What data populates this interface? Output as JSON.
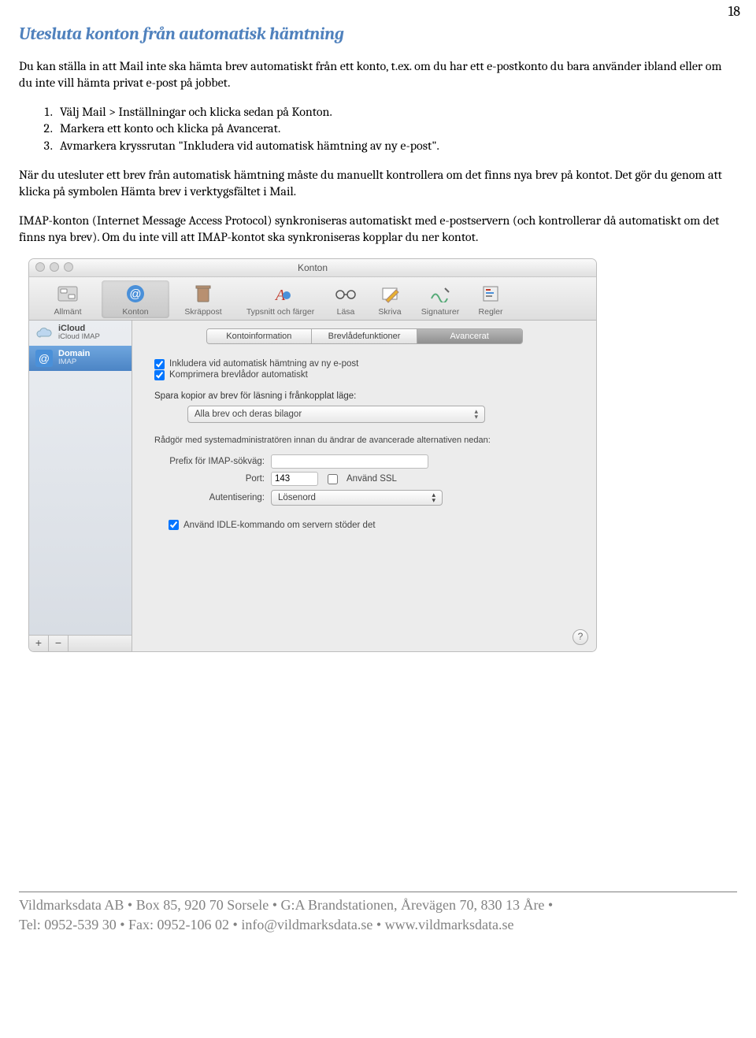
{
  "page_number": "18",
  "heading": "Utesluta konton från automatisk hämtning",
  "intro": "Du kan ställa in att Mail inte ska hämta brev automatiskt från ett konto, t.ex. om du har ett e-postkonto du bara använder ibland eller om du inte vill hämta privat e-post på jobbet.",
  "steps": [
    "Välj Mail > Inställningar och klicka sedan på Konton.",
    "Markera ett konto och klicka på Avancerat.",
    "Avmarkera kryssrutan \"Inkludera vid automatisk hämtning av ny e-post\"."
  ],
  "para2": "När du utesluter ett brev från automatisk hämtning måste du manuellt kontrollera om det finns nya brev på kontot. Det gör du genom att klicka på symbolen Hämta brev i verktygsfältet i Mail.",
  "para3": "IMAP-konton (Internet Message Access Protocol) synkroniseras automatiskt med e-postservern (och kontrollerar då automatiskt om det finns nya brev). Om du inte vill att IMAP-kontot ska synkroniseras kopplar du ner kontot.",
  "window": {
    "title": "Konton",
    "toolbar": [
      "Allmänt",
      "Konton",
      "Skräppost",
      "Typsnitt och färger",
      "Läsa",
      "Skriva",
      "Signaturer",
      "Regler"
    ],
    "accounts": [
      {
        "name": "iCloud",
        "sub": "iCloud IMAP"
      },
      {
        "name": "Domain",
        "sub": "IMAP"
      }
    ],
    "seg": [
      "Kontoinformation",
      "Brevlådefunktioner",
      "Avancerat"
    ],
    "chk1": "Inkludera vid automatisk hämtning av ny e-post",
    "chk2": "Komprimera brevlådor automatiskt",
    "copies_label": "Spara kopior av brev för läsning i frånkopplat läge:",
    "copies_value": "Alla brev och deras bilagor",
    "hint": "Rådgör med systemadministratören innan du ändrar de avancerade alternativen nedan:",
    "prefix_label": "Prefix för IMAP-sökväg:",
    "port_label": "Port:",
    "port_value": "143",
    "ssl_label": "Använd SSL",
    "auth_label": "Autentisering:",
    "auth_value": "Lösenord",
    "idle_label": "Använd IDLE-kommando om servern stöder det",
    "add": "+",
    "remove": "−",
    "help": "?"
  },
  "footer": {
    "line1": "Vildmarksdata AB • Box 85, 920 70 Sorsele • G:A Brandstationen, Årevägen 70, 830 13 Åre •",
    "line2": "Tel: 0952-539 30 • Fax: 0952-106 02 • info@vildmarksdata.se • www.vildmarksdata.se"
  }
}
